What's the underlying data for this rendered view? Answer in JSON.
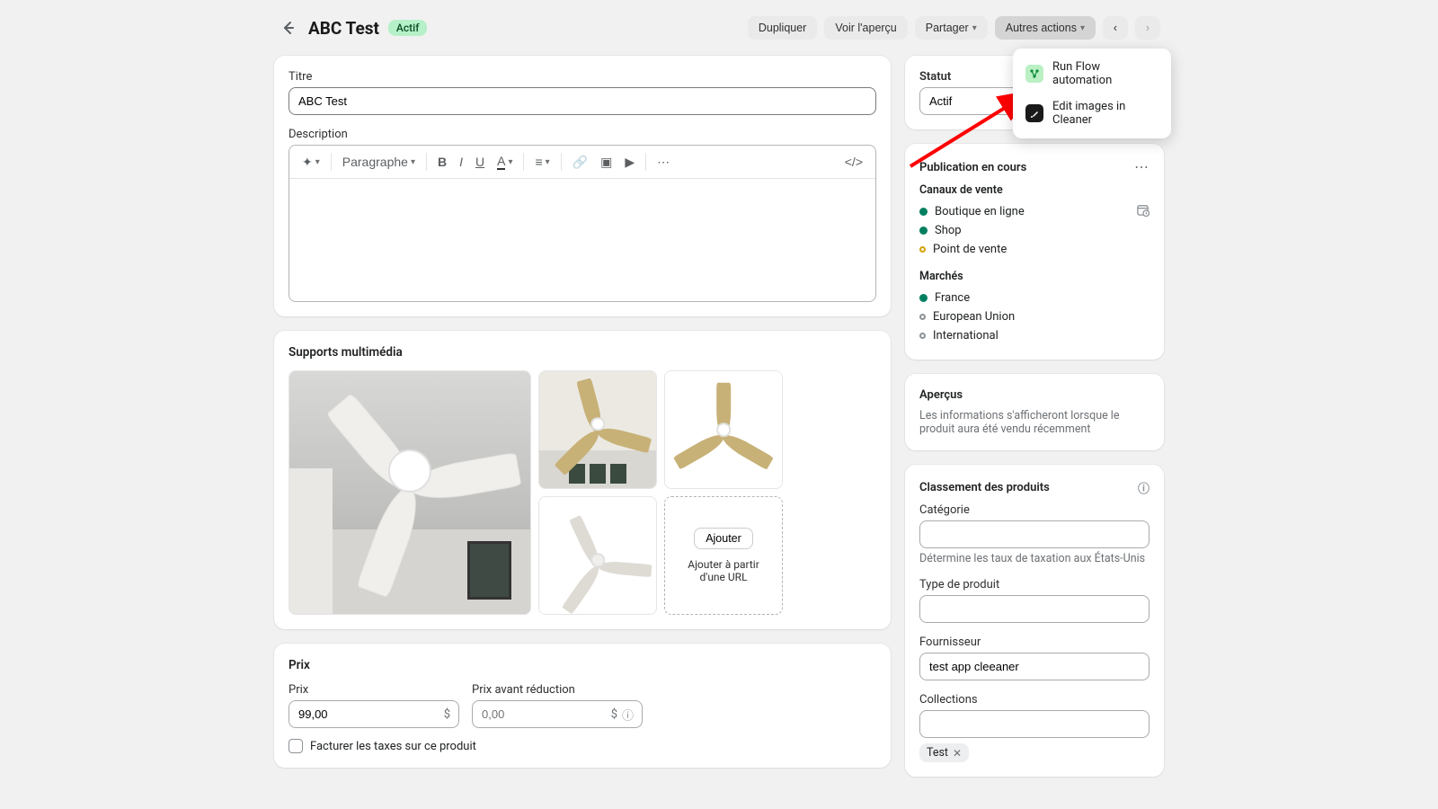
{
  "header": {
    "title": "ABC Test",
    "status_badge": "Actif",
    "buttons": {
      "duplicate": "Dupliquer",
      "preview": "Voir l'aperçu",
      "share": "Partager",
      "more": "Autres actions"
    }
  },
  "dropdown": {
    "flow": "Run Flow automation",
    "cleaner": "Edit images in Cleaner"
  },
  "main": {
    "title_label": "Titre",
    "title_value": "ABC Test",
    "description_label": "Description",
    "rte": {
      "paragraph": "Paragraphe"
    },
    "media": {
      "heading": "Supports multimédia",
      "add_button": "Ajouter",
      "add_from_url": "Ajouter à partir d'une URL"
    },
    "pricing": {
      "heading": "Prix",
      "price_label": "Prix",
      "price_value": "99,00",
      "compare_label": "Prix avant réduction",
      "compare_placeholder": "0,00",
      "currency": "$",
      "tax_checkbox": "Facturer les taxes sur ce produit"
    }
  },
  "side": {
    "status": {
      "label": "Statut",
      "value": "Actif"
    },
    "publishing": {
      "heading": "Publication en cours",
      "channels_label": "Canaux de vente",
      "channels": [
        {
          "name": "Boutique en ligne",
          "status": "green",
          "has_schedule": true
        },
        {
          "name": "Shop",
          "status": "green"
        },
        {
          "name": "Point de vente",
          "status": "yellow"
        }
      ],
      "markets_label": "Marchés",
      "markets": [
        {
          "name": "France",
          "status": "green"
        },
        {
          "name": "European Union",
          "status": "hollow"
        },
        {
          "name": "International",
          "status": "hollow"
        }
      ]
    },
    "insights": {
      "heading": "Aperçus",
      "text": "Les informations s'afficheront lorsque le produit aura été vendu récemment"
    },
    "organization": {
      "heading": "Classement des produits",
      "category_label": "Catégorie",
      "category_hint": "Détermine les taux de taxation aux États-Unis",
      "type_label": "Type de produit",
      "vendor_label": "Fournisseur",
      "vendor_value": "test app cleeaner",
      "collections_label": "Collections",
      "tag": "Test"
    }
  }
}
